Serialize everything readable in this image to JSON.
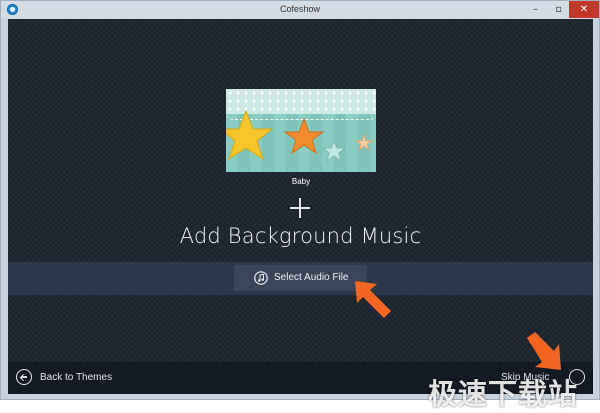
{
  "window": {
    "title": "Cofeshow",
    "controls": {
      "minimize": "–",
      "maximize": "▫",
      "close": "✕"
    }
  },
  "theme": {
    "name": "Baby",
    "thumbnail_icon": "baby-stars-thumbnail"
  },
  "main": {
    "heading": "Add Background Music",
    "plus_icon": "plus-icon"
  },
  "audio": {
    "select_label": "Select Audio File",
    "icon": "music-note-icon"
  },
  "footer": {
    "back_label": "Back to Themes",
    "back_icon": "arrow-left-circle-icon",
    "skip_label": "Skip Music",
    "skip_icon": "arrow-right-circle-icon"
  },
  "watermark": {
    "text": "极速下载站"
  },
  "colors": {
    "background": "#1f2732",
    "audio_bar": "#2c3847",
    "bottom_bar": "#141a23",
    "arrow": "#f26522",
    "close_button": "#c0392b"
  }
}
